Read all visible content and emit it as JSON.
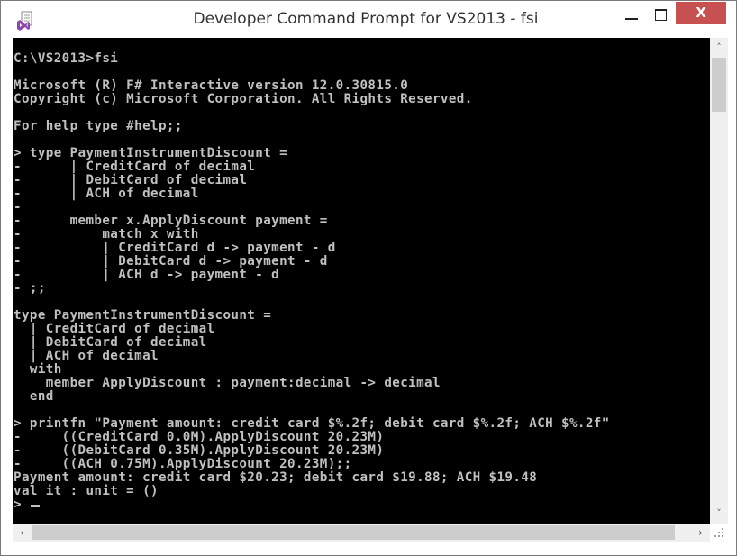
{
  "window": {
    "title": "Developer Command Prompt for VS2013 - fsi",
    "app_icon": "visual-studio-icon",
    "controls": {
      "minimize_icon": "minimize-icon",
      "maximize_icon": "maximize-icon",
      "close_label": "X"
    },
    "accent_close": "#c75050"
  },
  "console": {
    "background": "#000000",
    "foreground": "#c0c0c0",
    "lines": [
      "C:\\VS2013>fsi",
      "",
      "Microsoft (R) F# Interactive version 12.0.30815.0",
      "Copyright (c) Microsoft Corporation. All Rights Reserved.",
      "",
      "For help type #help;;",
      "",
      "> type PaymentInstrumentDiscount =",
      "-      | CreditCard of decimal",
      "-      | DebitCard of decimal",
      "-      | ACH of decimal",
      "-",
      "-      member x.ApplyDiscount payment =",
      "-          match x with",
      "-          | CreditCard d -> payment - d",
      "-          | DebitCard d -> payment - d",
      "-          | ACH d -> payment - d",
      "- ;;",
      "",
      "type PaymentInstrumentDiscount =",
      "  | CreditCard of decimal",
      "  | DebitCard of decimal",
      "  | ACH of decimal",
      "  with",
      "    member ApplyDiscount : payment:decimal -> decimal",
      "  end",
      "",
      "> printfn \"Payment amount: credit card $%.2f; debit card $%.2f; ACH $%.2f\"",
      "-     ((CreditCard 0.0M).ApplyDiscount 20.23M)",
      "-     ((DebitCard 0.35M).ApplyDiscount 20.23M)",
      "-     ((ACH 0.75M).ApplyDiscount 20.23M);;",
      "Payment amount: credit card $20.23; debit card $19.88; ACH $19.48",
      "val it : unit = ()",
      "> "
    ]
  },
  "scrollbars": {
    "vertical": {
      "up_icon": "^",
      "down_icon": "v",
      "position_fraction": 0.0
    },
    "horizontal": {
      "left_icon": "<",
      "right_icon": ">",
      "position_fraction": 0.0
    }
  }
}
